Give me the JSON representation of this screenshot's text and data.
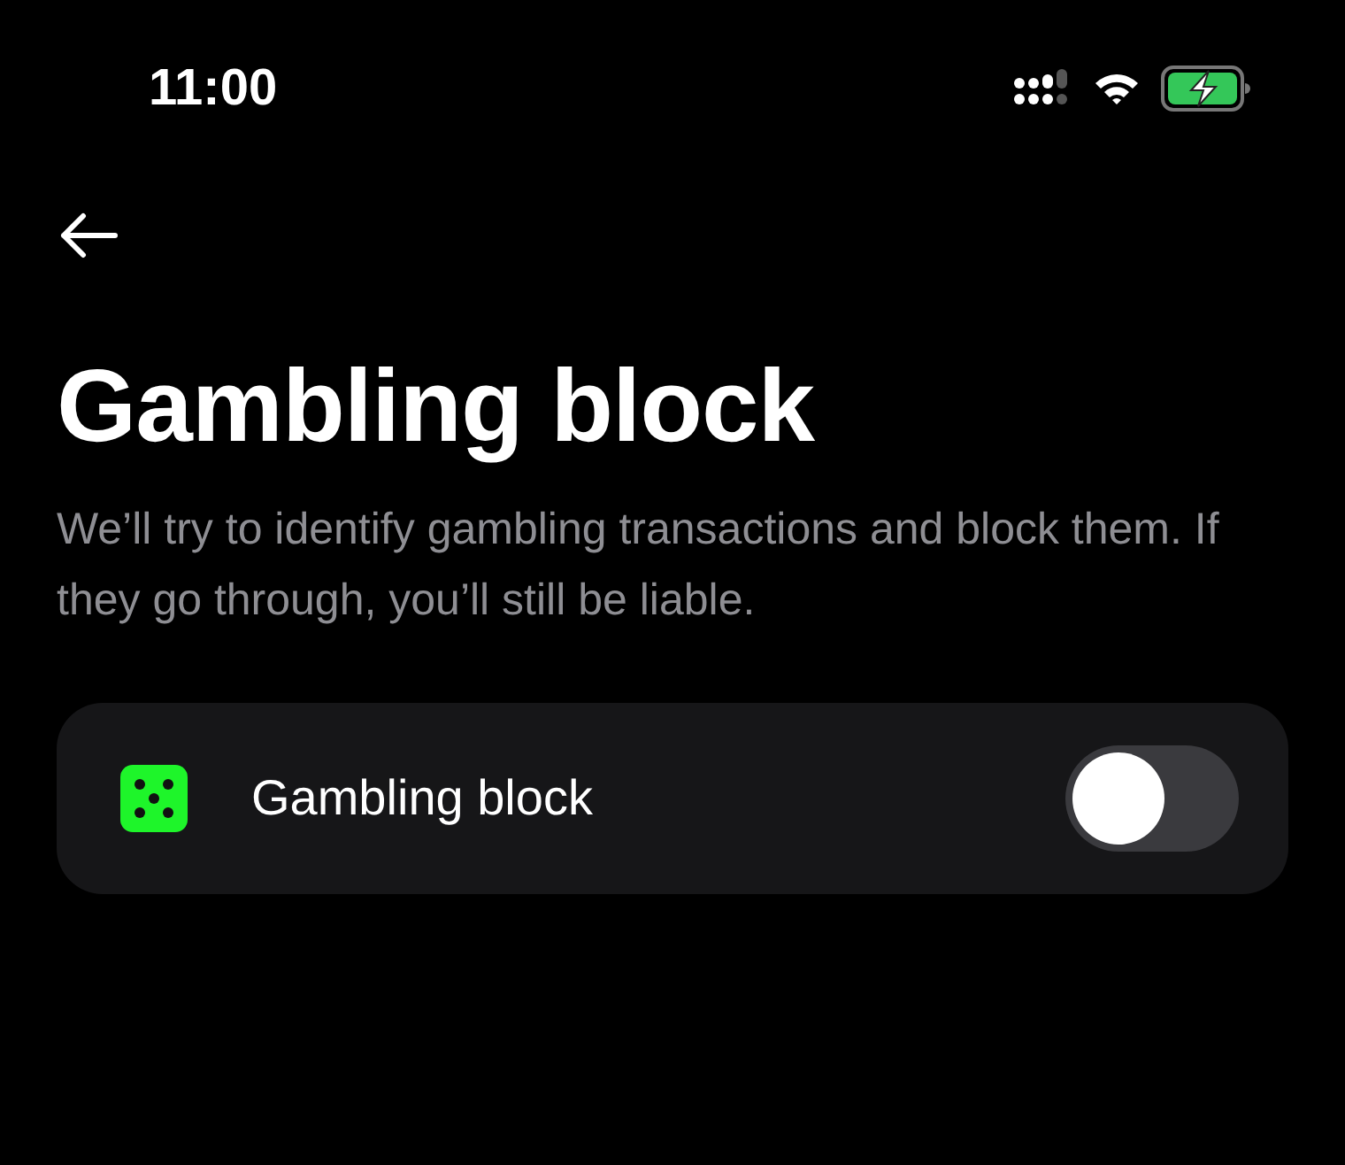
{
  "status_bar": {
    "time": "11:00"
  },
  "header": {
    "title": "Gambling block",
    "description": "We’ll try to identify gambling transactions and block them. If they go through, you’ll still be liable."
  },
  "settings": [
    {
      "kind": "toggle",
      "label": "Gambling block",
      "on": false
    }
  ]
}
